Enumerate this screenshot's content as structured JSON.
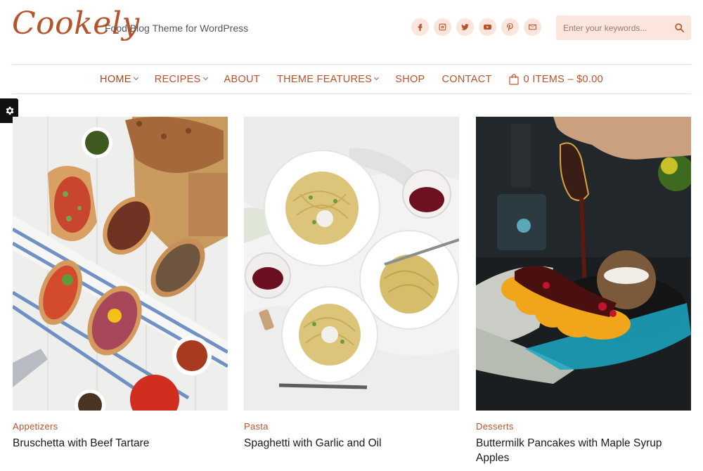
{
  "brand": {
    "logo": "Cookely",
    "tagline": "Food Blog Theme for WordPress",
    "accent": "#b7532b",
    "social_bg": "#fbe5dc"
  },
  "social_icons": [
    "facebook-icon",
    "instagram-icon",
    "twitter-icon",
    "youtube-icon",
    "pinterest-icon",
    "email-icon"
  ],
  "search": {
    "placeholder": "Enter your keywords..."
  },
  "nav": {
    "items": [
      {
        "label": "HOME",
        "dropdown": true
      },
      {
        "label": "RECIPES",
        "dropdown": true
      },
      {
        "label": "ABOUT",
        "dropdown": false
      },
      {
        "label": "THEME FEATURES",
        "dropdown": true
      },
      {
        "label": "SHOP",
        "dropdown": false
      },
      {
        "label": "CONTACT",
        "dropdown": false
      }
    ],
    "cart_label": "0 ITEMS – $0.00"
  },
  "posts": [
    {
      "category": "Appetizers",
      "title": "Bruschetta with Beef Tartare"
    },
    {
      "category": "Pasta",
      "title": "Spaghetti with Garlic and Oil"
    },
    {
      "category": "Desserts",
      "title": "Buttermilk Pancakes with Maple Syrup Apples"
    }
  ]
}
